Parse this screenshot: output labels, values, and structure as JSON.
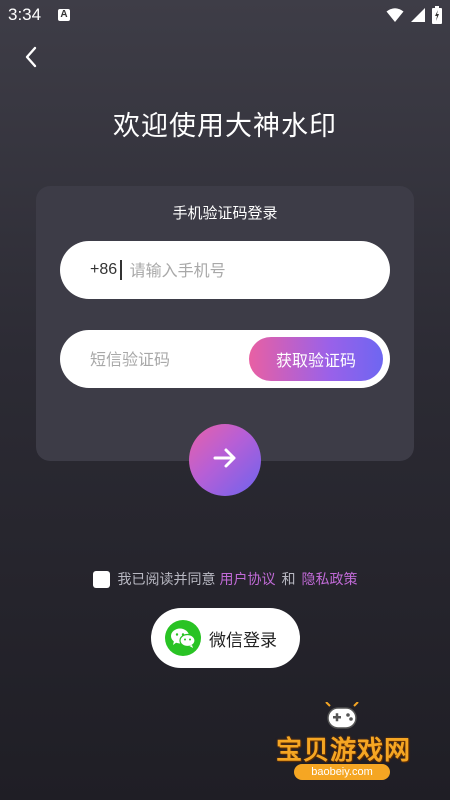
{
  "status_bar": {
    "time": "3:34",
    "notification_icon": "a-icon",
    "icons": [
      "wifi-icon",
      "signal-icon",
      "battery-icon"
    ]
  },
  "header": {
    "back_icon": "chevron-left-icon",
    "welcome_title": "欢迎使用大神水印"
  },
  "login_card": {
    "title": "手机验证码登录",
    "phone": {
      "prefix": "+86",
      "value": "",
      "placeholder": "请输入手机号"
    },
    "code": {
      "value": "",
      "placeholder": "短信验证码",
      "get_code_label": "获取验证码"
    },
    "submit_icon": "arrow-right-icon"
  },
  "agreement": {
    "checked": false,
    "prefix_text": "我已阅读并同意",
    "user_agreement": "用户协议",
    "connector": "和",
    "privacy_policy": "隐私政策"
  },
  "wechat": {
    "icon": "wechat-icon",
    "label": "微信登录"
  },
  "watermark": {
    "text": "宝贝游戏网",
    "url": "baobeiy.com"
  },
  "colors": {
    "background_top": "#3e3d47",
    "background_bottom": "#1f1e25",
    "card": "#3d3c47",
    "accent_pink": "#e860a3",
    "accent_purple": "#6e66f1",
    "link": "#c06ad6",
    "wechat_green": "#29c324"
  }
}
